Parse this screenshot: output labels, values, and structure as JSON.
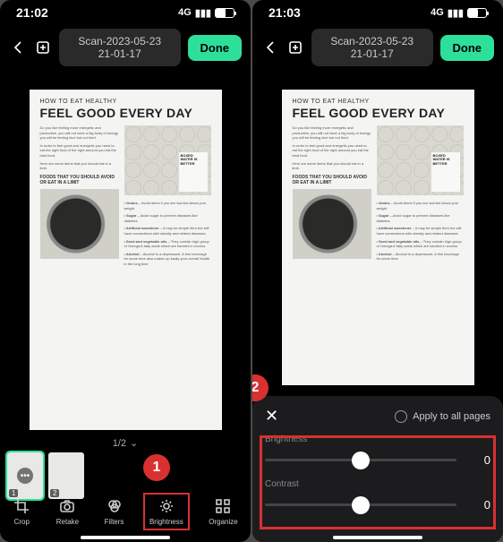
{
  "left": {
    "time": "21:02",
    "signal": "4G",
    "title": "Scan-2023-05-23 21-01-17",
    "done": "Done",
    "pageIndicator": "1/2",
    "thumbs": [
      {
        "num": "1"
      },
      {
        "num": "2"
      }
    ],
    "bottomBar": [
      {
        "label": "Crop"
      },
      {
        "label": "Retake"
      },
      {
        "label": "Filters"
      },
      {
        "label": "Brightness"
      },
      {
        "label": "Organize"
      }
    ]
  },
  "right": {
    "time": "21:03",
    "signal": "4G",
    "title": "Scan-2023-05-23 21-01-17",
    "done": "Done",
    "applyAll": "Apply to all pages",
    "sliders": {
      "brightness": {
        "label": "Brightness",
        "value": "0"
      },
      "contrast": {
        "label": "Contrast",
        "value": "0"
      }
    }
  },
  "doc": {
    "subtitle": "HOW TO EAT HEALTHY",
    "title": "FEEL GOOD EVERY DAY",
    "boxedWater": "BOXED WATER IS BETTER",
    "foodsHead": "FOODS THAT YOU SHOULD AVOID OR EAT IN A LIMIT"
  },
  "markers": {
    "one": "1",
    "two": "2"
  }
}
